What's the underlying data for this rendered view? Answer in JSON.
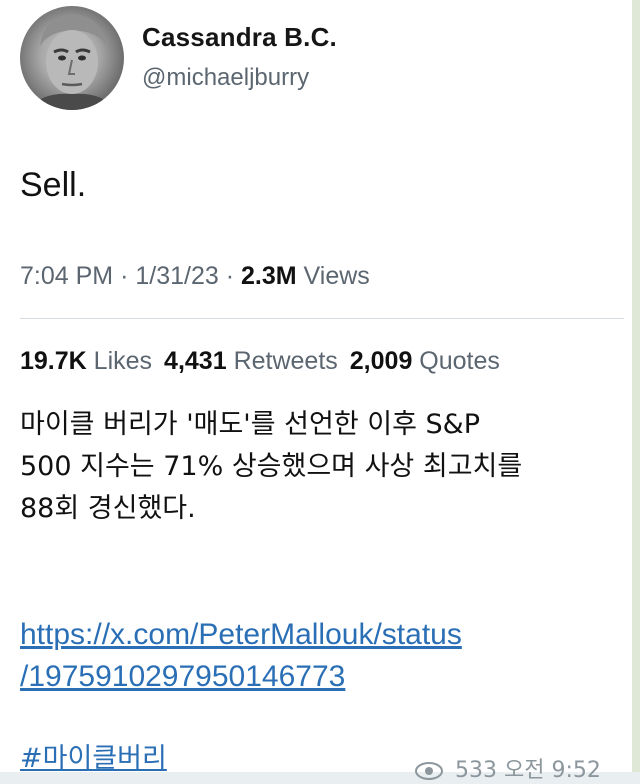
{
  "tweet": {
    "display_name": "Cassandra B.C.",
    "handle": "@michaeljburry",
    "text": "Sell.",
    "time": "7:04 PM",
    "date": "1/31/23",
    "separator": "·",
    "views_count": "2.3M",
    "views_label": "Views",
    "likes_count": "19.7K",
    "likes_label": "Likes",
    "retweets_count": "4,431",
    "retweets_label": "Retweets",
    "quotes_count": "2,009",
    "quotes_label": "Quotes",
    "avatar_icon": "profile-photo"
  },
  "message": {
    "lines": [
      "마이클 버리가 '매도'를 선언한 이후 S&P",
      "500 지수는 71% 상승했으며 사상 최고치를",
      "88회 경신했다."
    ],
    "link_line1": "https://x.com/PeterMallouk/status",
    "link_line2": "/1975910297950146773",
    "hashtag": "#마이클버리",
    "views": "533",
    "timestamp": "오전 9:52",
    "views_icon": "eye-icon"
  }
}
